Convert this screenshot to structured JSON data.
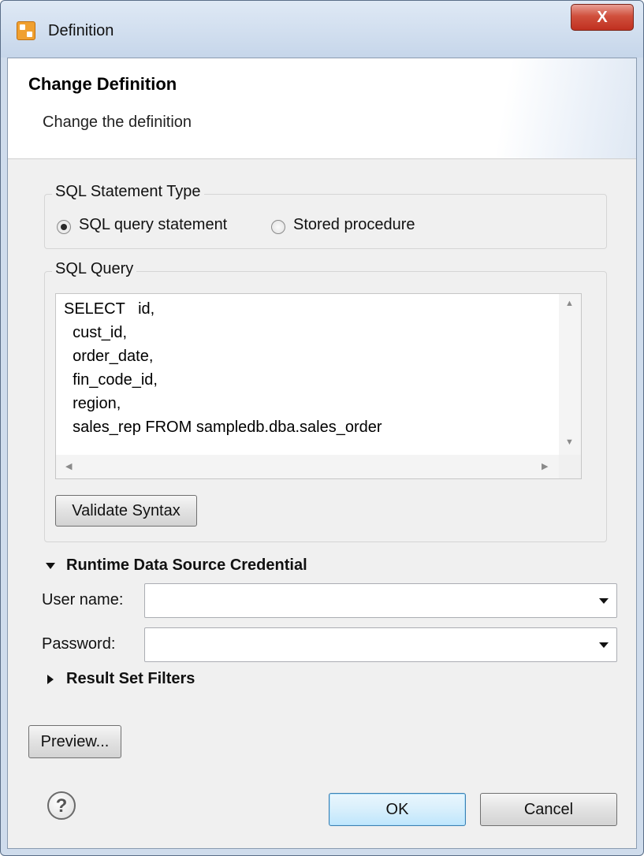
{
  "window": {
    "title": "Definition",
    "close_glyph": "X"
  },
  "banner": {
    "title": "Change Definition",
    "description": "Change the definition"
  },
  "statement_type": {
    "legend": "SQL Statement Type",
    "options": [
      {
        "label": "SQL query statement",
        "selected": true
      },
      {
        "label": "Stored procedure",
        "selected": false
      }
    ]
  },
  "query": {
    "legend": "SQL Query",
    "lines": [
      "SELECT   id,",
      "  cust_id,",
      "  order_date,",
      "  fin_code_id,",
      "  region,",
      "  sales_rep FROM sampledb.dba.sales_order"
    ],
    "validate_label": "Validate Syntax"
  },
  "credential": {
    "heading": "Runtime Data Source Credential",
    "expanded": true,
    "user_label": "User name:",
    "user_value": "",
    "password_label": "Password:",
    "password_value": ""
  },
  "filters": {
    "heading": "Result Set Filters",
    "expanded": false
  },
  "buttons": {
    "preview": "Preview...",
    "ok": "OK",
    "cancel": "Cancel",
    "help_glyph": "?"
  },
  "icons": {
    "app": "data-set-icon",
    "help": "help-icon",
    "expand": "triangle-down-icon",
    "collapse": "triangle-right-icon"
  }
}
